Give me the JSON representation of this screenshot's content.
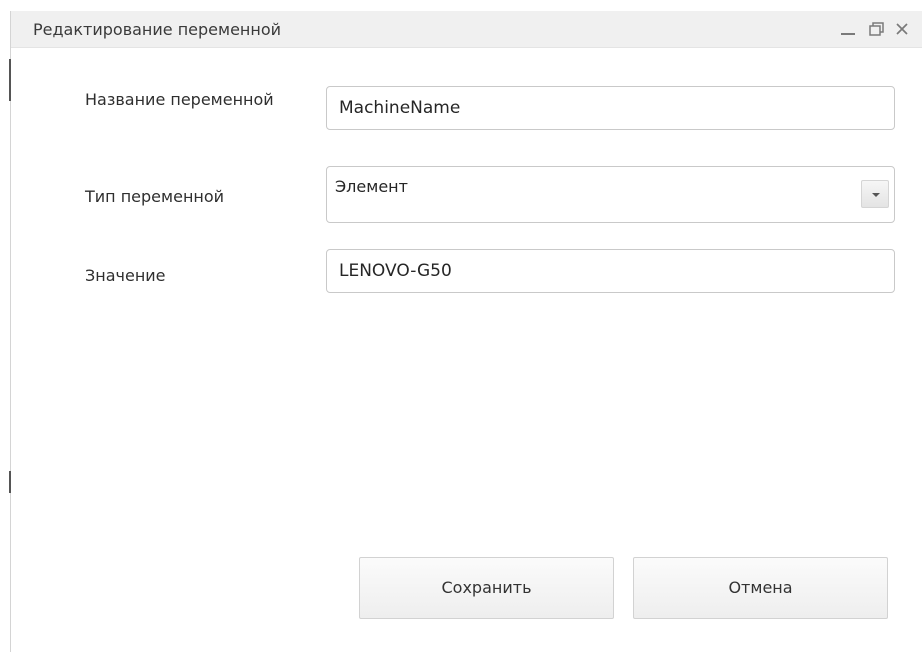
{
  "window": {
    "title": "Редактирование переменной",
    "controls": {
      "minimize_icon": "minimize-icon",
      "restore_icon": "restore-icon",
      "close_icon": "close-icon"
    }
  },
  "form": {
    "variable_name": {
      "label": "Название переменной",
      "value": "MachineName"
    },
    "variable_type": {
      "label": "Тип переменной",
      "selected": "Элемент"
    },
    "variable_value": {
      "label": "Значение",
      "value": "LENOVO-G50"
    }
  },
  "buttons": {
    "save": "Сохранить",
    "cancel": "Отмена"
  },
  "colors": {
    "titlebar": "#f0f0f0",
    "border": "#c9c9c9",
    "button_bg": "#f3f3f3",
    "text": "#2f2f2f"
  }
}
